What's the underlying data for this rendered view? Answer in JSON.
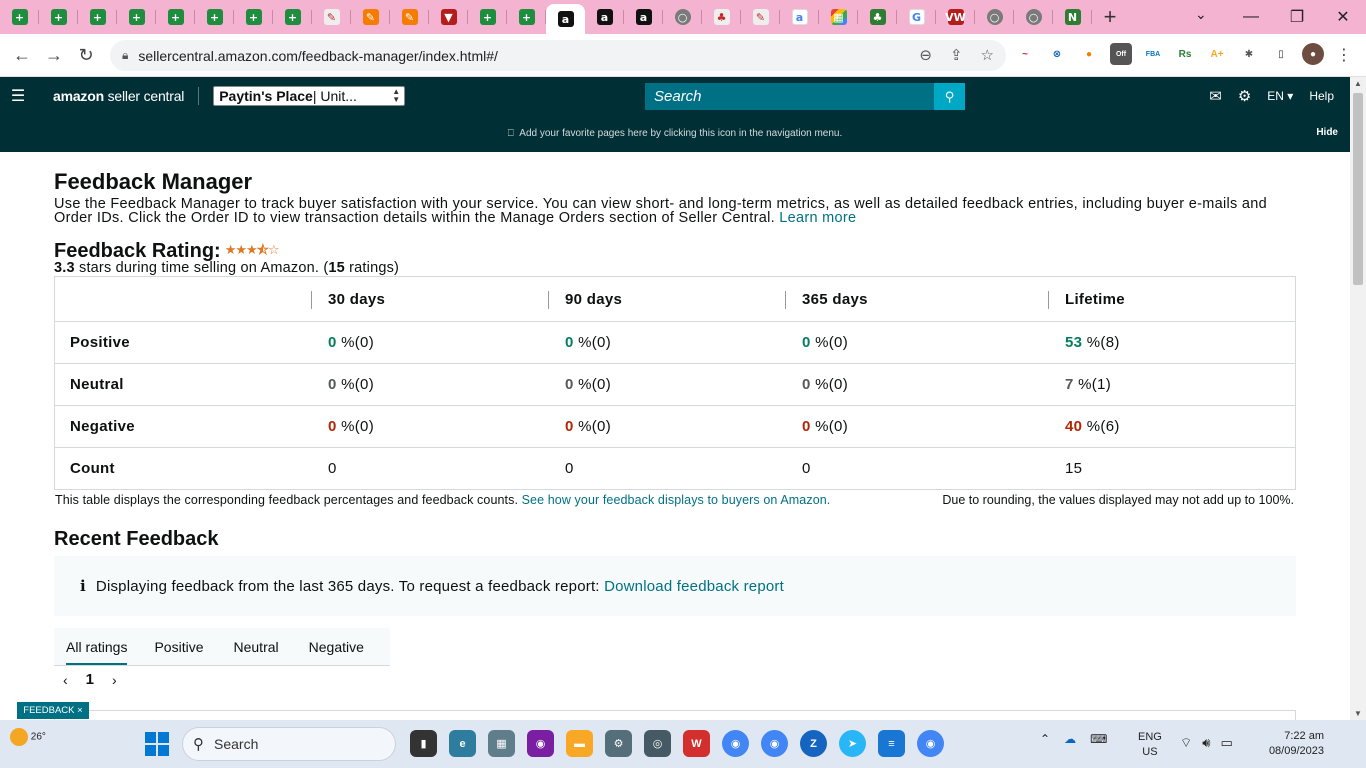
{
  "browser": {
    "url": "sellercentral.amazon.com/feedback-manager/index.html#/",
    "tab_glyphs": [
      "+",
      "+",
      "+",
      "+",
      "+",
      "+",
      "+",
      "+",
      "✎",
      "✎",
      "✎",
      "▼",
      "+",
      "+",
      "a",
      "a",
      "a",
      "○",
      "♣",
      "✎",
      "a",
      "▦",
      "♣",
      "G",
      "VW",
      "○",
      "○",
      "N"
    ]
  },
  "header": {
    "logo_word1": "amazon",
    "logo_word2": " seller central",
    "store_name": "Paytin's Place",
    "store_region": " | Unit...",
    "search_placeholder": "Search",
    "language": "EN",
    "help": "Help"
  },
  "bookmarks_bar": {
    "message": "Add your favorite pages here by clicking this icon in the navigation menu.",
    "hide": "Hide"
  },
  "page": {
    "title": "Feedback Manager",
    "intro": "Use the Feedback Manager to track buyer satisfaction with your service. You can view short- and long-term metrics, as well as detailed feedback entries, including buyer e-mails and Order IDs. Click the Order ID to view transaction details within the Manage Orders section of Seller Central. ",
    "learn_more": "Learn more",
    "rating_title": "Feedback Rating:",
    "stars_glyph": "★★★⯪☆",
    "rating_value": "3.3",
    "rating_text": " stars during time selling on Amazon. (",
    "rating_count": "15",
    "rating_suffix": " ratings)"
  },
  "table": {
    "headers": [
      "30 days",
      "90 days",
      "365 days",
      "Lifetime"
    ],
    "rows": [
      {
        "label": "Positive",
        "cells": [
          {
            "pct": "0",
            "rest": " %(0)"
          },
          {
            "pct": "0",
            "rest": " %(0)"
          },
          {
            "pct": "0",
            "rest": " %(0)"
          },
          {
            "pct": "53",
            "rest": " %(8)"
          }
        ]
      },
      {
        "label": "Neutral",
        "cells": [
          {
            "pct": "0",
            "rest": " %(0)"
          },
          {
            "pct": "0",
            "rest": " %(0)"
          },
          {
            "pct": "0",
            "rest": " %(0)"
          },
          {
            "pct": "7",
            "rest": " %(1)"
          }
        ]
      },
      {
        "label": "Negative",
        "cells": [
          {
            "pct": "0",
            "rest": " %(0)"
          },
          {
            "pct": "0",
            "rest": " %(0)"
          },
          {
            "pct": "0",
            "rest": " %(0)"
          },
          {
            "pct": "40",
            "rest": " %(6)"
          }
        ]
      },
      {
        "label": "Count",
        "cells": [
          "0",
          "0",
          "0",
          "15"
        ]
      }
    ],
    "note": "This table displays the corresponding feedback percentages and feedback counts. ",
    "note_link": "See how your feedback displays to buyers on Amazon.",
    "note_right": "Due to rounding, the values displayed may not add up to 100%."
  },
  "recent": {
    "title": "Recent Feedback",
    "info_icon": "i",
    "info_text": "Displaying feedback from the last 365 days. To request a feedback report: ",
    "info_link": "Download feedback report",
    "tabs": [
      "All ratings",
      "Positive",
      "Neutral",
      "Negative"
    ],
    "page_prev": "‹",
    "page_current": "1",
    "page_next": "›"
  },
  "feedback_tab": "FEEDBACK ×",
  "taskbar": {
    "temperature": "26°",
    "search": "Search",
    "lang_line1": "ENG",
    "lang_line2": "US",
    "time": "7:22 am",
    "date": "08/09/2023"
  },
  "colors": {
    "header_bg": "#002f36",
    "link": "#007185",
    "positive": "#067d62",
    "negative": "#b12704",
    "tabstrip": "#f5b3d2"
  }
}
